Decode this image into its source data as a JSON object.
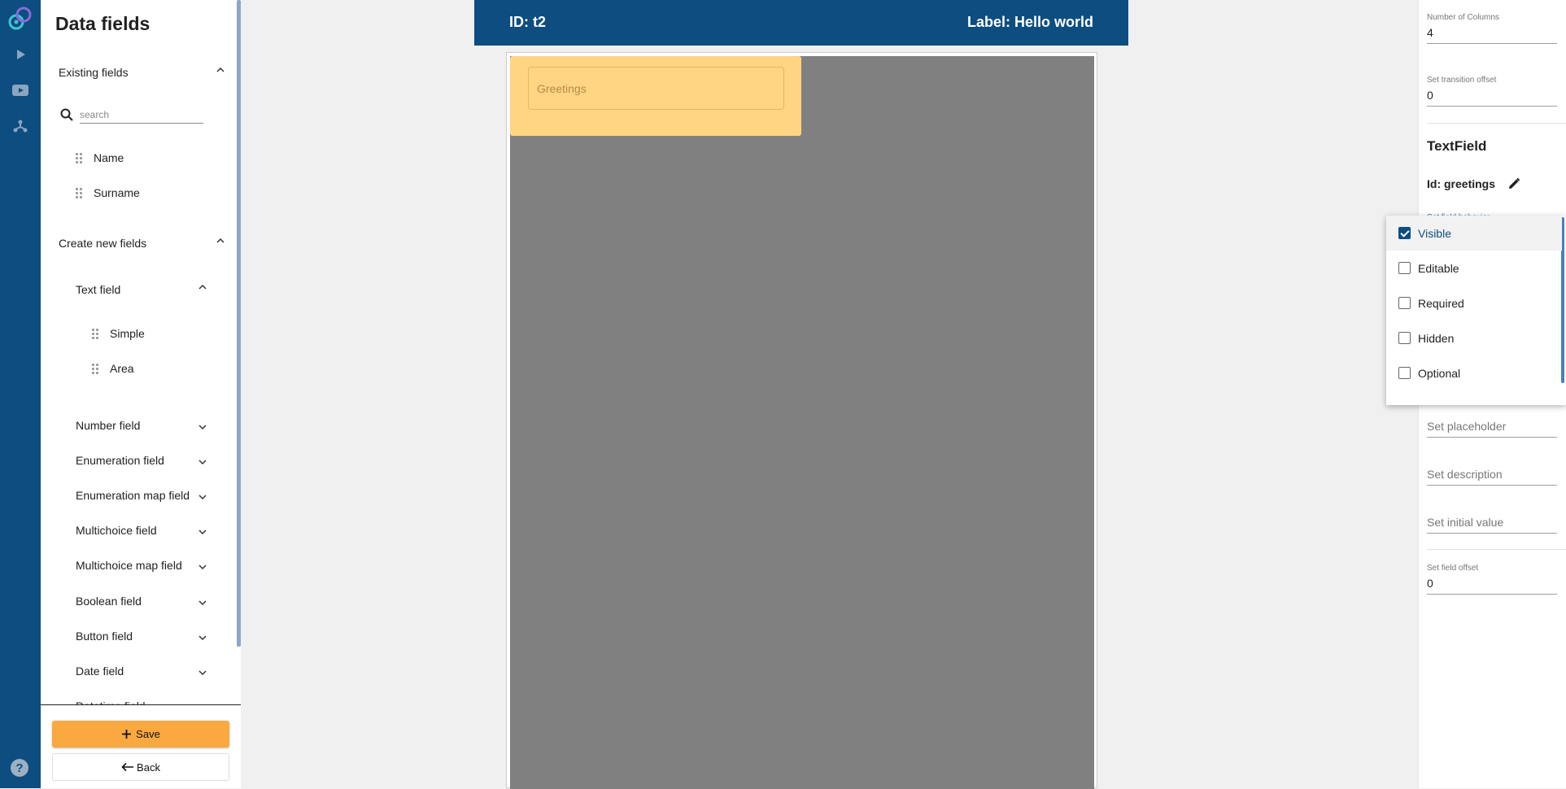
{
  "panel": {
    "title": "Data fields",
    "existing_label": "Existing fields",
    "search_placeholder": "search",
    "existing_items": [
      "Name",
      "Surname"
    ],
    "create_label": "Create new fields",
    "text_field_label": "Text field",
    "text_subitems": [
      "Simple",
      "Area"
    ],
    "field_types": [
      "Number field",
      "Enumeration field",
      "Enumeration map field",
      "Multichoice field",
      "Multichoice map field",
      "Boolean field",
      "Button field",
      "Date field",
      "Datetime field"
    ],
    "save_label": "Save",
    "back_label": "Back"
  },
  "banner": {
    "id_text": "ID: t2",
    "label_text": "Label: Hello world"
  },
  "canvas": {
    "field_label": "Greetings"
  },
  "props": {
    "columns_caption": "Number of Columns",
    "columns_value": "4",
    "transition_caption": "Set transition offset",
    "transition_value": "0",
    "section_title": "TextField",
    "field_id": "Id: greetings",
    "behavior_caption": "Set field behavior",
    "placeholder_label": "Set placeholder",
    "description_label": "Set description",
    "initial_label": "Set initial value",
    "offset_caption": "Set field offset",
    "offset_value": "0"
  },
  "dropdown": {
    "options": [
      {
        "label": "Visible",
        "checked": true
      },
      {
        "label": "Editable",
        "checked": false
      },
      {
        "label": "Required",
        "checked": false
      },
      {
        "label": "Hidden",
        "checked": false
      },
      {
        "label": "Optional",
        "checked": false
      }
    ]
  },
  "colors": {
    "brand": "#0d4d80",
    "accent": "#f9a940",
    "field_card": "#ffd483",
    "canvas_grey": "#808080"
  },
  "icons": [
    "logo-icon",
    "play-icon",
    "video-icon",
    "workflow-icon",
    "help-icon",
    "search-icon",
    "chevron-up-icon",
    "chevron-down-icon",
    "drag-handle-icon",
    "plus-icon",
    "arrow-left-icon",
    "pencil-icon",
    "checkbox-icon"
  ]
}
